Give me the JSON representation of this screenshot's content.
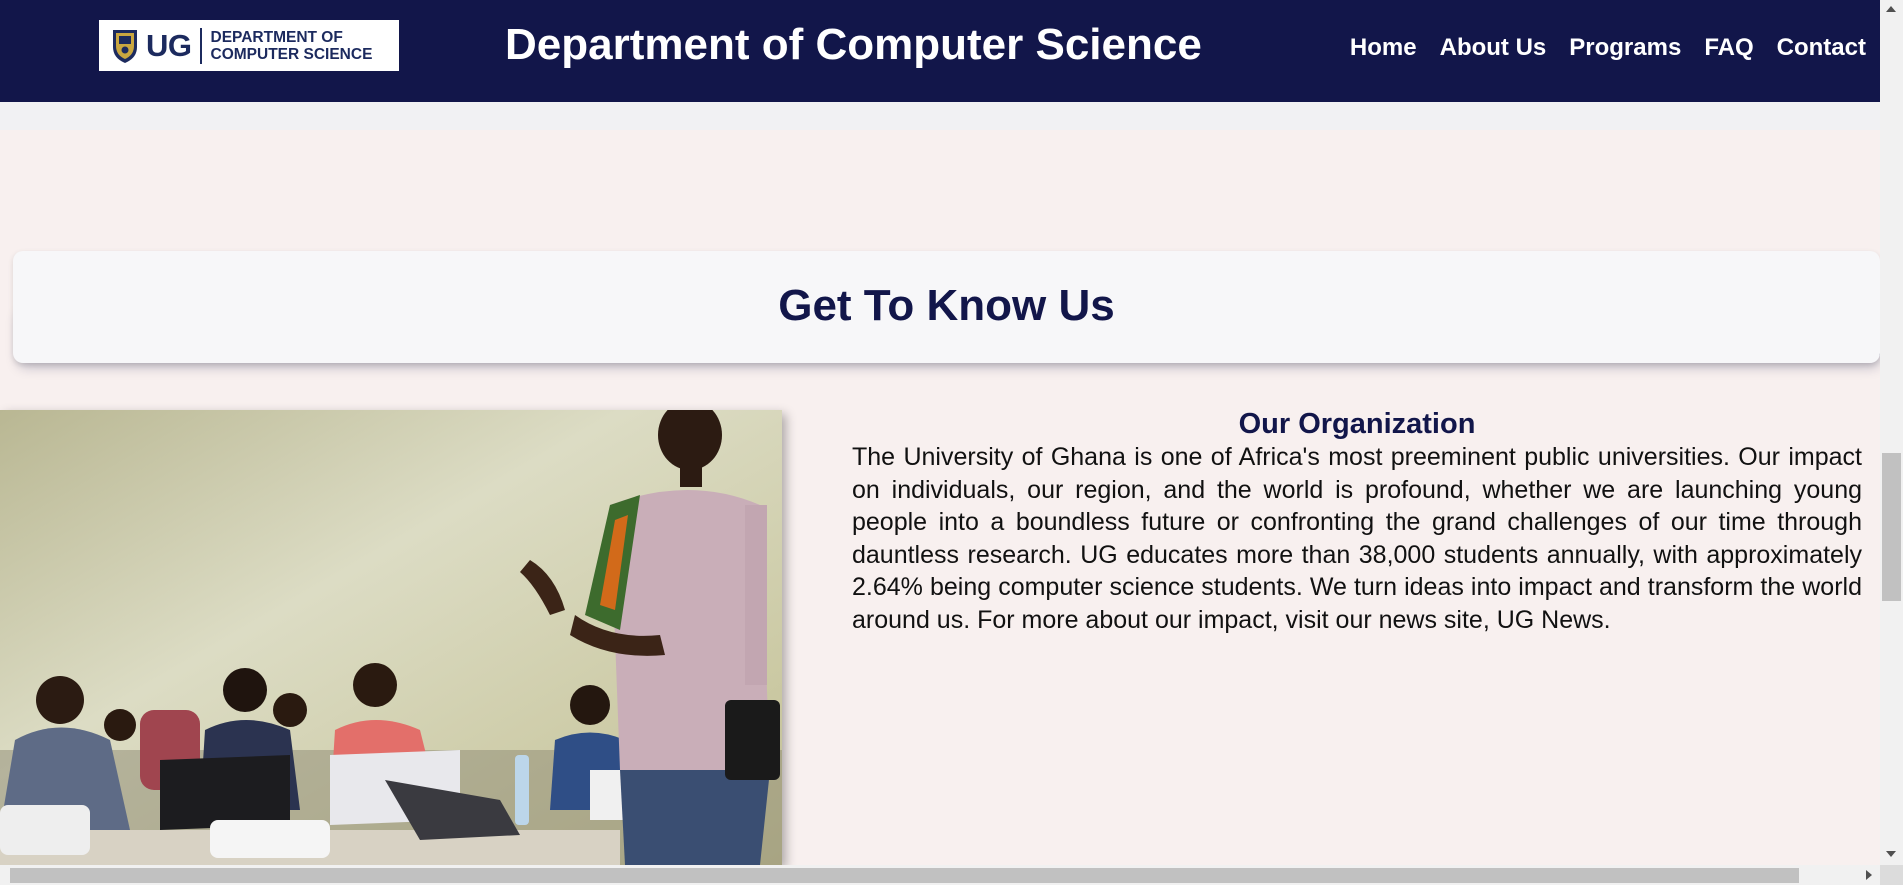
{
  "header": {
    "logo": {
      "mark": "UG",
      "line1": "DEPARTMENT OF",
      "line2": "COMPUTER SCIENCE",
      "icon": "crest-icon"
    },
    "title": "Department of Computer Science",
    "nav": [
      {
        "label": "Home"
      },
      {
        "label": "About Us"
      },
      {
        "label": "Programs"
      },
      {
        "label": "FAQ"
      },
      {
        "label": "Contact"
      }
    ]
  },
  "hero": {
    "heading": "Get To Know Us"
  },
  "organization": {
    "title": "Our Organization",
    "body": "The University of Ghana is one of Africa's most preeminent public universities. Our impact on individuals, our region, and the world is profound, whether we are launching young people into a boundless future or confronting the grand challenges of our time through dauntless research. UG educates more than 38,000 students annually, with approximately 2.64% being computer science students. We turn ideas into impact and transform the world around us. For more about our impact, visit our news site, UG News.",
    "photo": "classroom-photo"
  },
  "colors": {
    "navy": "#12164a",
    "page_bg": "#f8f0ef",
    "card_bg": "#f7f7f9"
  }
}
